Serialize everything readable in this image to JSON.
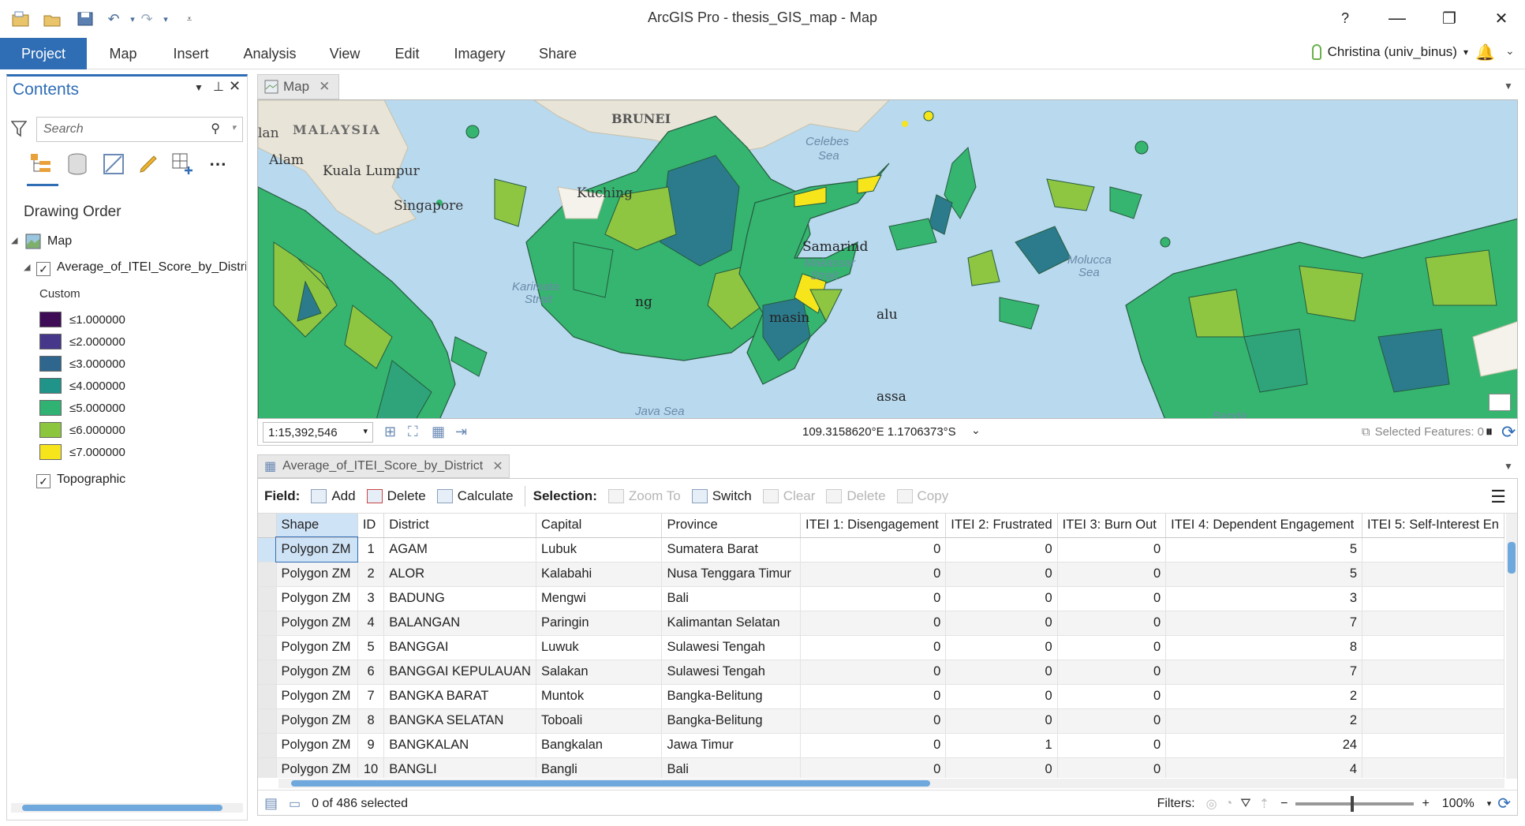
{
  "window": {
    "title": "ArcGIS Pro - thesis_GIS_map - Map",
    "help": "?",
    "minimize": "—",
    "restore": "❐",
    "close": "✕"
  },
  "ribbon": {
    "tabs": [
      "Project",
      "Map",
      "Insert",
      "Analysis",
      "View",
      "Edit",
      "Imagery",
      "Share"
    ]
  },
  "user": {
    "name": "Christina (univ_binus)",
    "caret": "▾"
  },
  "contents": {
    "title": "Contents",
    "search_placeholder": "Search",
    "section": "Drawing Order",
    "map_node": "Map",
    "layer": "Average_of_ITEI_Score_by_District",
    "legend_heading": "Custom",
    "legend": [
      {
        "label": "≤1.000000",
        "color": "#3f0d55"
      },
      {
        "label": "≤2.000000",
        "color": "#46378a"
      },
      {
        "label": "≤3.000000",
        "color": "#2e668d"
      },
      {
        "label": "≤4.000000",
        "color": "#21948a"
      },
      {
        "label": "≤5.000000",
        "color": "#2fb272"
      },
      {
        "label": "≤6.000000",
        "color": "#8cc63e"
      },
      {
        "label": "≤7.000000",
        "color": "#f7e51c"
      }
    ],
    "basemap": "Topographic"
  },
  "map": {
    "tab": "Map",
    "labels": {
      "malaysia": "MALAYSIA",
      "brunei": "BRUNEI",
      "kuala_lumpur": "Kuala Lumpur",
      "alam": "Alam",
      "singapore": "Singapore",
      "kuching": "Kuching",
      "samarinda": "Samarind",
      "celebes": "Celebes",
      "sea1": "Sea",
      "molucca": "Molucca",
      "sea2": "Sea",
      "makassar": "Makassar",
      "strait1": "Strait",
      "karimata": "Karimata",
      "strait2": "Strait",
      "java_sea": "Java Sea",
      "banda": "Banda",
      "lan": "lan",
      "ng": "ng",
      "masin": "masin",
      "palu": "alu",
      "assa": "assa"
    },
    "scale": "1:15,392,546",
    "coordinates": "109.3158620°E 1.1706373°S",
    "selected_features": "Selected Features: 0"
  },
  "table": {
    "tab": "Average_of_ITEI_Score_by_District",
    "toolbar": {
      "field_label": "Field:",
      "add": "Add",
      "delete": "Delete",
      "calculate": "Calculate",
      "selection_label": "Selection:",
      "zoom_to": "Zoom To",
      "switch": "Switch",
      "clear": "Clear",
      "sel_delete": "Delete",
      "copy": "Copy"
    },
    "columns": [
      "Shape",
      "ID",
      "District",
      "Capital",
      "Province",
      "ITEI 1: Disengagement",
      "ITEI 2: Frustrated",
      "ITEI 3: Burn Out",
      "ITEI 4: Dependent Engagement",
      "ITEI 5: Self-Interest En"
    ],
    "rows": [
      [
        "Polygon ZM",
        "1",
        "AGAM",
        "Lubuk",
        "Sumatera Barat",
        "0",
        "0",
        "0",
        "5",
        ""
      ],
      [
        "Polygon ZM",
        "2",
        "ALOR",
        "Kalabahi",
        "Nusa Tenggara Timur",
        "0",
        "0",
        "0",
        "5",
        ""
      ],
      [
        "Polygon ZM",
        "3",
        "BADUNG",
        "Mengwi",
        "Bali",
        "0",
        "0",
        "0",
        "3",
        ""
      ],
      [
        "Polygon ZM",
        "4",
        "BALANGAN",
        "Paringin",
        "Kalimantan Selatan",
        "0",
        "0",
        "0",
        "7",
        ""
      ],
      [
        "Polygon ZM",
        "5",
        "BANGGAI",
        "Luwuk",
        "Sulawesi Tengah",
        "0",
        "0",
        "0",
        "8",
        ""
      ],
      [
        "Polygon ZM",
        "6",
        "BANGGAI KEPULAUAN",
        "Salakan",
        "Sulawesi Tengah",
        "0",
        "0",
        "0",
        "7",
        ""
      ],
      [
        "Polygon ZM",
        "7",
        "BANGKA BARAT",
        "Muntok",
        "Bangka-Belitung",
        "0",
        "0",
        "0",
        "2",
        ""
      ],
      [
        "Polygon ZM",
        "8",
        "BANGKA SELATAN",
        "Toboali",
        "Bangka-Belitung",
        "0",
        "0",
        "0",
        "2",
        ""
      ],
      [
        "Polygon ZM",
        "9",
        "BANGKALAN",
        "Bangkalan",
        "Jawa Timur",
        "0",
        "1",
        "0",
        "24",
        ""
      ],
      [
        "Polygon ZM",
        "10",
        "BANGLI",
        "Bangli",
        "Bali",
        "0",
        "0",
        "0",
        "4",
        ""
      ]
    ],
    "footer": {
      "selected": "0 of 486 selected",
      "filters": "Filters:",
      "zoom": "100%"
    }
  }
}
